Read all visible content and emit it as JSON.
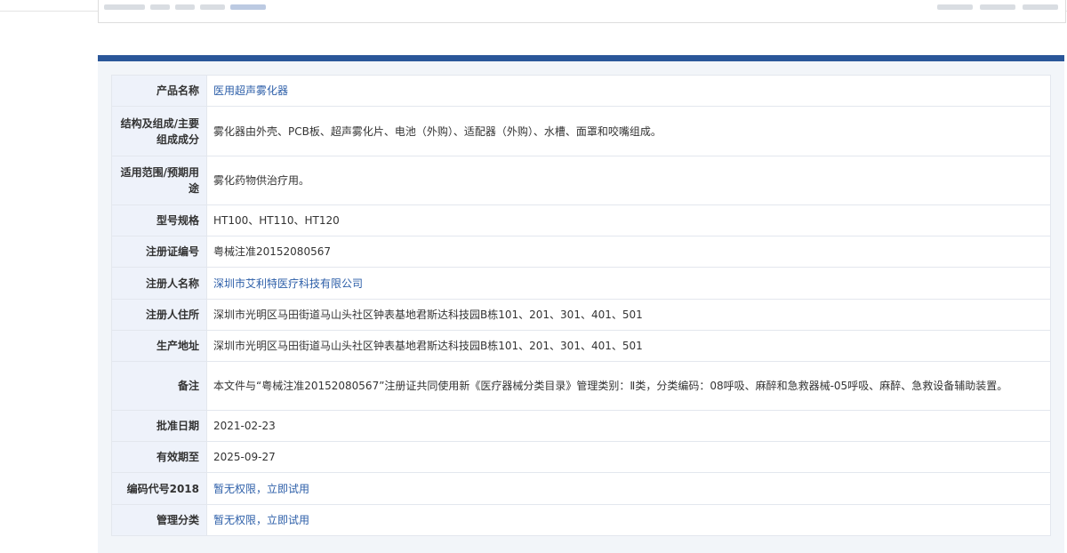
{
  "rows": [
    {
      "label": "产品名称",
      "value": "医用超声雾化器",
      "link": true
    },
    {
      "label": "结构及组成/主要组成成分",
      "value": "雾化器由外壳、PCB板、超声雾化片、电池（外购）、适配器（外购）、水槽、面罩和咬嘴组成。"
    },
    {
      "label": "适用范围/预期用途",
      "value": "雾化药物供治疗用。"
    },
    {
      "label": "型号规格",
      "value": "HT100、HT110、HT120"
    },
    {
      "label": "注册证编号",
      "value": "粤械注准20152080567"
    },
    {
      "label": "注册人名称",
      "value": "深圳市艾利特医疗科技有限公司",
      "link": true
    },
    {
      "label": "注册人住所",
      "value": "深圳市光明区马田街道马山头社区钟表基地君斯达科技园B栋101、201、301、401、501"
    },
    {
      "label": "生产地址",
      "value": "深圳市光明区马田街道马山头社区钟表基地君斯达科技园B栋101、201、301、401、501"
    },
    {
      "label": "备注",
      "value": "本文件与“粤械注准20152080567”注册证共同使用新《医疗器械分类目录》管理类别：Ⅱ类，分类编码：08呼吸、麻醉和急救器械-05呼吸、麻醉、急救设备辅助装置。"
    },
    {
      "label": "批准日期",
      "value": "2021-02-23"
    },
    {
      "label": "有效期至",
      "value": "2025-09-27"
    },
    {
      "label": "编码代号2018",
      "value": "暂无权限，立即试用",
      "link": true
    },
    {
      "label": "管理分类",
      "value": "暂无权限，立即试用",
      "link": true
    }
  ],
  "colors": {
    "accent": "#2a5699",
    "link": "#2c5ea8"
  }
}
